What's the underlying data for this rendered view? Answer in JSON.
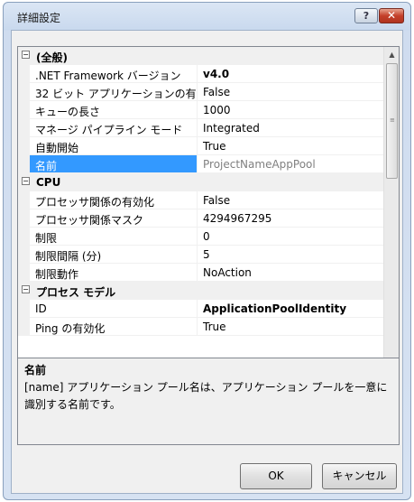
{
  "window": {
    "title": "詳細設定",
    "help_label": "?",
    "close_label": "✕"
  },
  "categories": [
    {
      "label": "(全般)",
      "toggle": "⊟",
      "properties": [
        {
          "name": ".NET Framework バージョン",
          "value": "v4.0",
          "style": "bold"
        },
        {
          "name": "32 ビット アプリケーションの有",
          "value": "False",
          "style": "normal"
        },
        {
          "name": "キューの長さ",
          "value": "1000",
          "style": "normal"
        },
        {
          "name": "マネージ パイプライン モード",
          "value": "Integrated",
          "style": "normal"
        },
        {
          "name": "自動開始",
          "value": "True",
          "style": "normal"
        },
        {
          "name": "名前",
          "value": "ProjectNameAppPool",
          "style": "gray",
          "selected": true
        }
      ]
    },
    {
      "label": "CPU",
      "toggle": "⊟",
      "properties": [
        {
          "name": "プロセッサ関係の有効化",
          "value": "False",
          "style": "normal"
        },
        {
          "name": "プロセッサ関係マスク",
          "value": "4294967295",
          "style": "normal"
        },
        {
          "name": "制限",
          "value": "0",
          "style": "normal"
        },
        {
          "name": "制限間隔 (分)",
          "value": "5",
          "style": "normal"
        },
        {
          "name": "制限動作",
          "value": "NoAction",
          "style": "normal"
        }
      ]
    },
    {
      "label": "プロセス モデル",
      "toggle": "⊟",
      "properties": [
        {
          "name": "ID",
          "value": "ApplicationPoolIdentity",
          "style": "bold"
        },
        {
          "name": "Ping の有効化",
          "value": "True",
          "style": "normal"
        }
      ]
    }
  ],
  "description": {
    "title": "名前",
    "text": "[name] アプリケーション プール名は、アプリケーション プールを一意に識別する名前です。"
  },
  "buttons": {
    "ok": "OK",
    "cancel": "キャンセル"
  },
  "icons": {
    "scroll_up": "up-arrow-icon",
    "scroll_down": "down-arrow-icon",
    "collapse": "minus-box-icon"
  }
}
